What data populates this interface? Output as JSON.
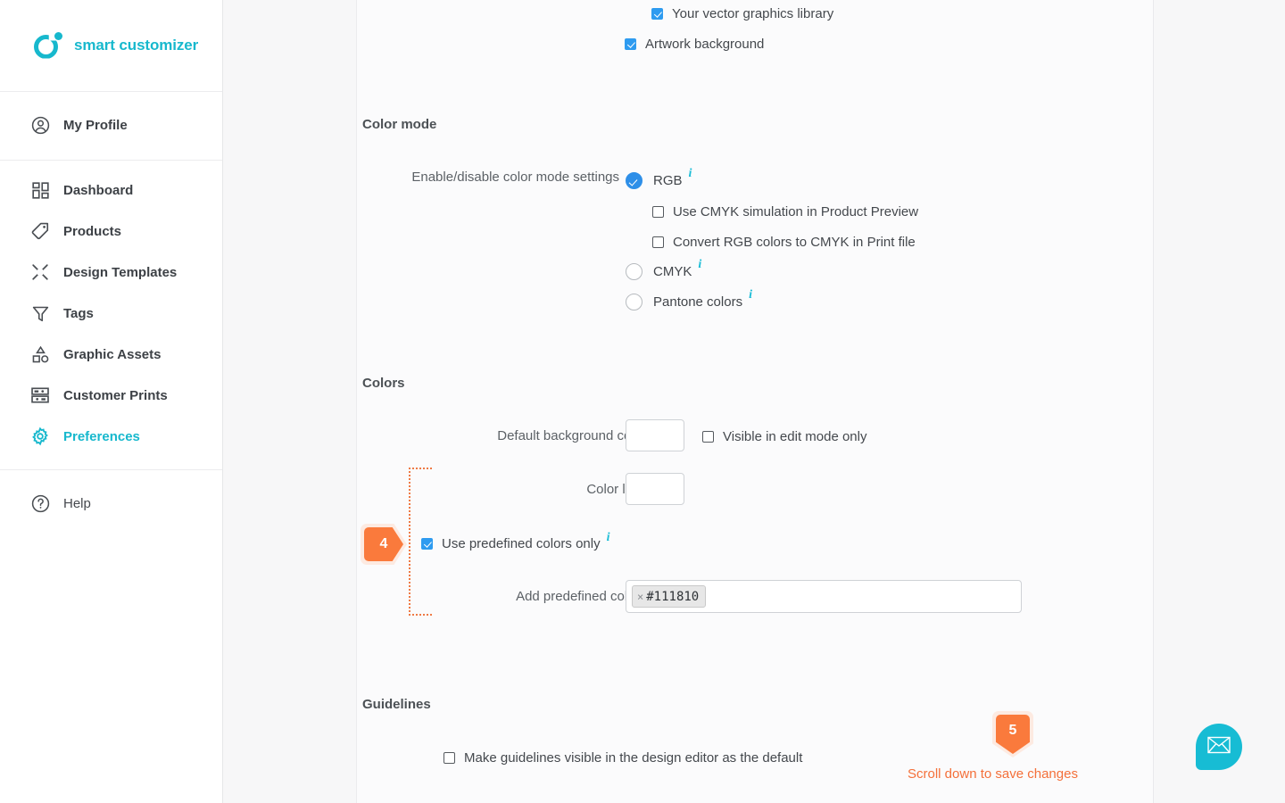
{
  "brand": {
    "name": "smart customizer",
    "accent": "#17b8cd"
  },
  "sidebar": {
    "profile": {
      "label": "My Profile",
      "icon": "user-circle-icon"
    },
    "items": [
      {
        "label": "Dashboard",
        "icon": "dashboard-grid-icon",
        "active": false
      },
      {
        "label": "Products",
        "icon": "tag-icon",
        "active": false
      },
      {
        "label": "Design Templates",
        "icon": "design-templates-icon",
        "active": false
      },
      {
        "label": "Tags",
        "icon": "funnel-icon",
        "active": false
      },
      {
        "label": "Graphic Assets",
        "icon": "graphic-assets-icon",
        "active": false
      },
      {
        "label": "Customer Prints",
        "icon": "customer-prints-icon",
        "active": false
      },
      {
        "label": "Preferences",
        "icon": "gear-icon",
        "active": true
      }
    ],
    "help": {
      "label": "Help",
      "icon": "help-circle-icon"
    }
  },
  "main": {
    "top_checkboxes": [
      {
        "label": "Your vector graphics library",
        "checked": true
      },
      {
        "label": "Artwork background",
        "checked": true
      }
    ],
    "color_mode": {
      "title": "Color mode",
      "field_label": "Enable/disable color mode settings",
      "options": [
        {
          "label": "RGB",
          "selected": true,
          "has_info": true
        },
        {
          "label": "CMYK",
          "selected": false,
          "has_info": true
        },
        {
          "label": "Pantone colors",
          "selected": false,
          "has_info": true
        }
      ],
      "rgb_suboptions": [
        {
          "label": "Use CMYK simulation in Product Preview",
          "checked": false
        },
        {
          "label": "Convert RGB colors to CMYK in Print file",
          "checked": false
        }
      ]
    },
    "colors": {
      "title": "Colors",
      "default_background_color": {
        "label": "Default background color",
        "value": ""
      },
      "visible_in_edit_mode_only": {
        "label": "Visible in edit mode only",
        "checked": false
      },
      "color_limit": {
        "label": "Color limit",
        "value": ""
      },
      "use_predefined_colors_only": {
        "label": "Use predefined colors only",
        "checked": true,
        "has_info": true
      },
      "add_predefined_colors": {
        "label": "Add predefined colors",
        "has_info": true,
        "chips": [
          {
            "value": "#111810",
            "remove": "×"
          }
        ]
      }
    },
    "guidelines": {
      "title": "Guidelines",
      "make_visible": {
        "label": "Make guidelines visible in the design editor as the default",
        "checked": false
      }
    },
    "steps": [
      {
        "number": "4",
        "direction": "right"
      },
      {
        "number": "5",
        "direction": "down"
      }
    ],
    "scroll_note": "Scroll down to save changes",
    "scroll_note_color": "#f4703a"
  },
  "chat": {
    "icon": "envelope-icon",
    "color": "#17bcd4"
  }
}
